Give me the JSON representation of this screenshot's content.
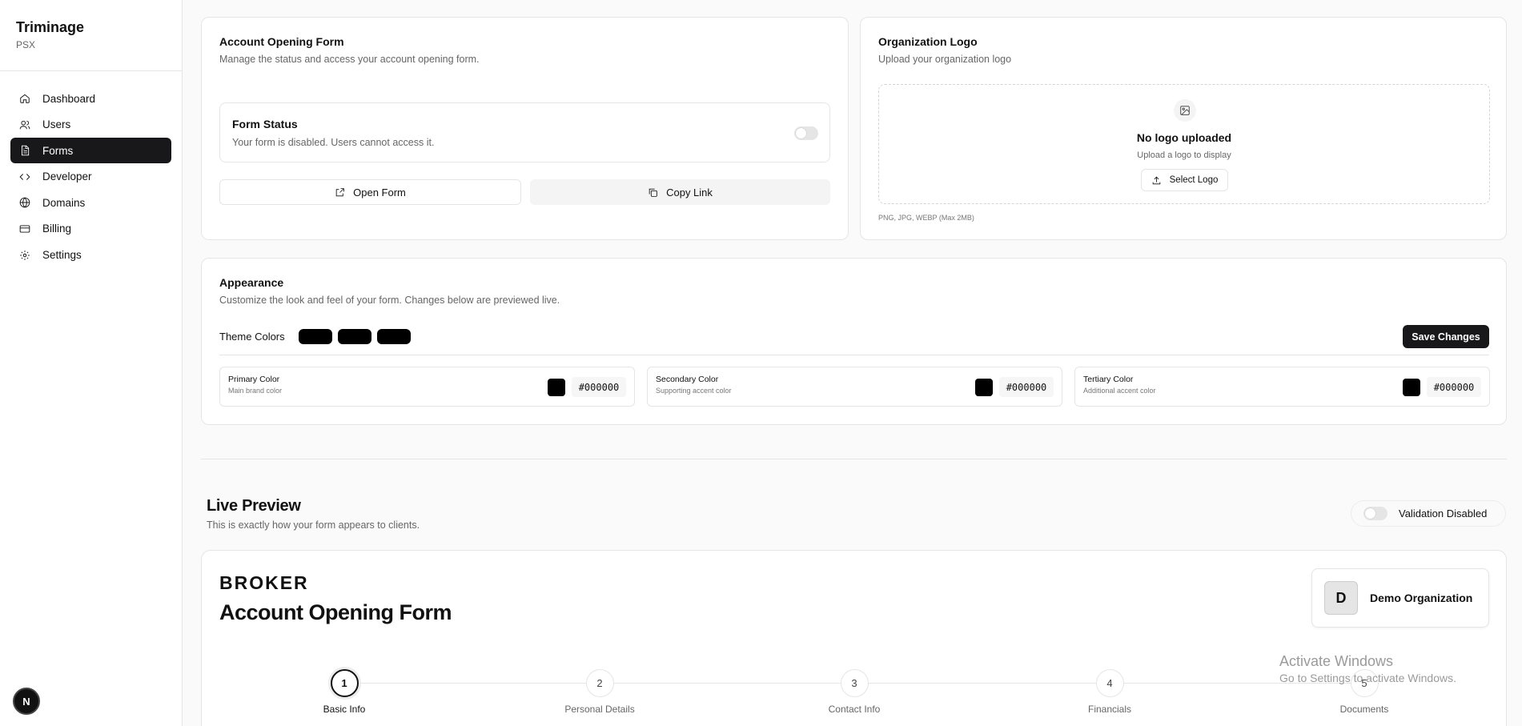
{
  "sidebar": {
    "brand_name": "Triminage",
    "brand_sub": "PSX",
    "items": [
      {
        "label": "Dashboard",
        "icon": "home-icon",
        "active": false
      },
      {
        "label": "Users",
        "icon": "users-icon",
        "active": false
      },
      {
        "label": "Forms",
        "icon": "file-icon",
        "active": true
      },
      {
        "label": "Developer",
        "icon": "code-icon",
        "active": false
      },
      {
        "label": "Domains",
        "icon": "globe-icon",
        "active": false
      },
      {
        "label": "Billing",
        "icon": "credit-card-icon",
        "active": false
      },
      {
        "label": "Settings",
        "icon": "gear-icon",
        "active": false
      }
    ],
    "badge_letter": "N"
  },
  "form_card": {
    "title": "Account Opening Form",
    "description": "Manage the status and access your account opening form.",
    "status_title": "Form Status",
    "status_desc": "Your form is disabled. Users cannot access it.",
    "status_enabled": false,
    "open_label": "Open Form",
    "copy_label": "Copy Link"
  },
  "logo_card": {
    "title": "Organization Logo",
    "description": "Upload your organization logo",
    "empty_title": "No logo uploaded",
    "empty_sub": "Upload a logo to display",
    "select_label": "Select Logo",
    "file_hint": "PNG, JPG, WEBP (Max 2MB)"
  },
  "appearance": {
    "title": "Appearance",
    "description": "Customize the look and feel of your form. Changes below are previewed live.",
    "theme_label": "Theme Colors",
    "save_label": "Save Changes",
    "colors": [
      {
        "name": "Primary Color",
        "sub": "Main brand color",
        "hex": "#000000"
      },
      {
        "name": "Secondary Color",
        "sub": "Supporting accent color",
        "hex": "#000000"
      },
      {
        "name": "Tertiary Color",
        "sub": "Additional accent color",
        "hex": "#000000"
      }
    ]
  },
  "preview": {
    "title": "Live Preview",
    "subtitle": "This is exactly how your form appears to clients.",
    "validation_label": "Validation Disabled",
    "brand": "BROKER",
    "form_title": "Account Opening Form",
    "org_initial": "D",
    "org_name": "Demo Organization",
    "steps": [
      {
        "num": "1",
        "label": "Basic Info",
        "active": true
      },
      {
        "num": "2",
        "label": "Personal Details",
        "active": false
      },
      {
        "num": "3",
        "label": "Contact Info",
        "active": false
      },
      {
        "num": "4",
        "label": "Financials",
        "active": false
      },
      {
        "num": "5",
        "label": "Documents",
        "active": false
      }
    ]
  },
  "watermark": {
    "title": "Activate Windows",
    "sub": "Go to Settings to activate Windows."
  }
}
